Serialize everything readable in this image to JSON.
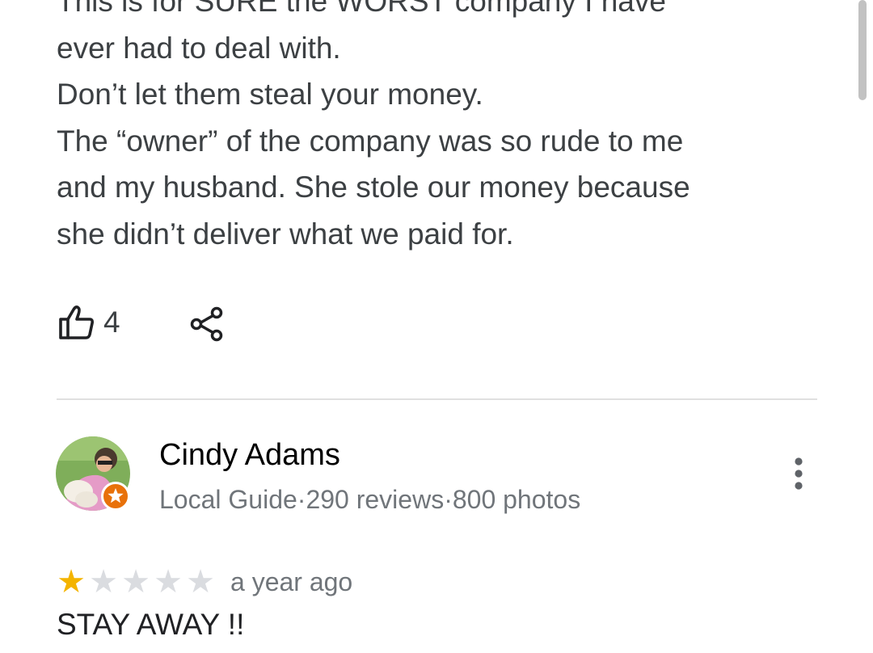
{
  "review1": {
    "text_lines": [
      "This is for SURE the WORST company I have",
      "ever had to deal with.",
      "Don’t let them steal your money.",
      "The “owner” of the company was so rude to me",
      "and my husband. She stole our money because",
      "she didn’t deliver what we paid for."
    ],
    "like_count": "4",
    "icons": {
      "like": "thumbs-up-icon",
      "share": "share-icon"
    }
  },
  "review2": {
    "reviewer": {
      "name": "Cindy Adams",
      "meta": "Local Guide·290 reviews·800 photos",
      "badge_icon": "local-guide-badge-icon"
    },
    "rating": 1,
    "rating_max": 5,
    "time": "a year ago",
    "text": "STAY AWAY !!",
    "more_icon": "more-vert-icon"
  },
  "colors": {
    "star_filled": "#f4b400",
    "star_empty": "#dadce0",
    "text_primary": "#3c4043",
    "text_secondary": "#70757a",
    "divider": "#e0e0e0",
    "badge": "#e8710a"
  }
}
